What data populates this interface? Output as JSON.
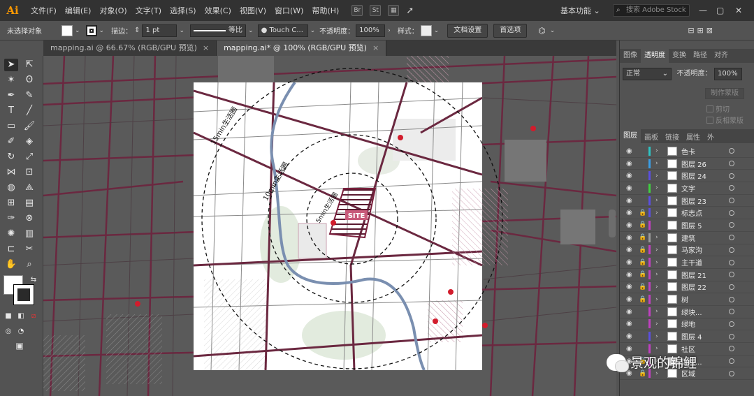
{
  "app": {
    "logo": "Ai"
  },
  "menu": [
    "文件(F)",
    "编辑(E)",
    "对象(O)",
    "文字(T)",
    "选择(S)",
    "效果(C)",
    "视图(V)",
    "窗口(W)",
    "帮助(H)"
  ],
  "menubar_icons": {
    "bridge": "Br",
    "stock": "St"
  },
  "workspace": "基本功能",
  "search": {
    "placeholder": "搜索 Adobe Stock"
  },
  "control": {
    "selection": "未选择对象",
    "stroke_label": "描边：",
    "stroke_weight": "1 pt",
    "profile": "等比",
    "brush": "Touch C...",
    "opacity_label": "不透明度：",
    "opacity": "100%",
    "style_label": "样式：",
    "doc_setup": "文档设置",
    "prefs": "首选项"
  },
  "tabs": [
    {
      "label": "mapping.ai @ 66.67% (RGB/GPU 预览)",
      "close": "×"
    },
    {
      "label": "mapping.ai* @ 100% (RGB/GPU 预览)",
      "close": "×"
    }
  ],
  "panel_tabs_top": [
    "图像",
    "透明度",
    "变换",
    "路径",
    "对齐"
  ],
  "transparency": {
    "blend": "正常",
    "opacity_label": "不透明度：",
    "opacity": "100%",
    "make_mask": "制作蒙版",
    "clip": "剪切",
    "invert": "反相蒙版"
  },
  "panel_tabs_bottom": [
    "图层",
    "画板",
    "链接",
    "属性",
    "外"
  ],
  "layers": [
    {
      "name": "色卡",
      "color": "#2ec4c4",
      "locked": false,
      "expand": true
    },
    {
      "name": "图层 26",
      "color": "#3a9ee6",
      "locked": false,
      "expand": true
    },
    {
      "name": "图层 24",
      "color": "#5b4fe0",
      "locked": false,
      "expand": true
    },
    {
      "name": "文字",
      "color": "#40d040",
      "locked": false,
      "expand": true
    },
    {
      "name": "图层 23",
      "color": "#5b4fe0",
      "locked": false,
      "expand": true
    },
    {
      "name": "标志点",
      "color": "#5b4fe0",
      "locked": true,
      "expand": true
    },
    {
      "name": "图层 5",
      "color": "#c040c0",
      "locked": true,
      "expand": false
    },
    {
      "name": "建筑",
      "color": "#9a9a9a",
      "locked": true,
      "expand": true
    },
    {
      "name": "马家沟",
      "color": "#c040c0",
      "locked": true,
      "expand": true
    },
    {
      "name": "主干道",
      "color": "#c040c0",
      "locked": true,
      "expand": true
    },
    {
      "name": "图层 21",
      "color": "#c040c0",
      "locked": true,
      "expand": true
    },
    {
      "name": "图层 22",
      "color": "#c040c0",
      "locked": true,
      "expand": true
    },
    {
      "name": "树",
      "color": "#c040c0",
      "locked": true,
      "expand": true
    },
    {
      "name": "绿块...",
      "color": "#c040c0",
      "locked": false,
      "expand": true
    },
    {
      "name": "绿地",
      "color": "#c040c0",
      "locked": false,
      "expand": true
    },
    {
      "name": "图层 4",
      "color": "#5b4fe0",
      "locked": false,
      "expand": true
    },
    {
      "name": "社区",
      "color": "#c040c0",
      "locked": false,
      "expand": true
    },
    {
      "name": "区域...",
      "color": "#c040c0",
      "locked": true,
      "expand": true
    },
    {
      "name": "区域",
      "color": "#c040c0",
      "locked": true,
      "expand": true
    }
  ],
  "map": {
    "ring_15": "15min生活圈",
    "ring_10": "10min生活圈",
    "ring_5": "5min生活圈",
    "site": "SITE"
  },
  "watermark": "景观的锦鲤",
  "colors": {
    "road": "#6b2840",
    "river": "#7a8fb0",
    "accent": "#ff9a00"
  }
}
